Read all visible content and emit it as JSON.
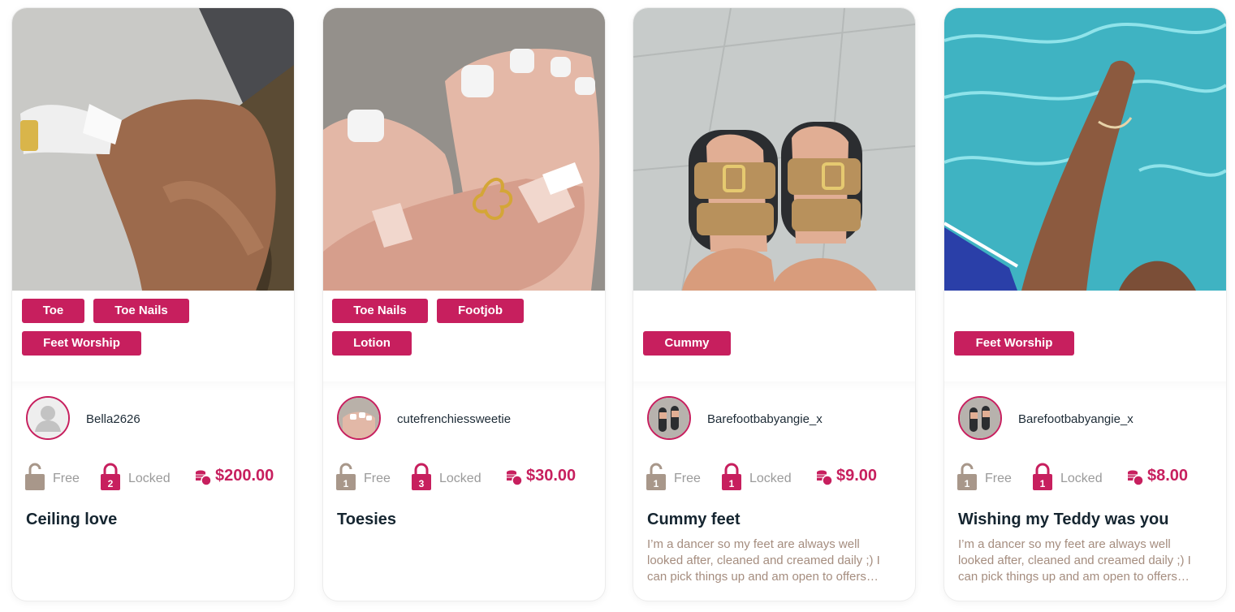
{
  "cards": [
    {
      "tags": [
        "Toe",
        "Toe Nails",
        "Feet Worship"
      ],
      "username": "Bella2626",
      "avatar": "default-avatar-icon",
      "free_count": "",
      "free_label": "Free",
      "locked_count": "2",
      "locked_label": "Locked",
      "price": "$200.00",
      "title": "Ceiling love",
      "description": ""
    },
    {
      "tags": [
        "Toe Nails",
        "Footjob",
        "Lotion"
      ],
      "username": "cutefrenchiessweetie",
      "avatar": "photo",
      "free_count": "1",
      "free_label": "Free",
      "locked_count": "3",
      "locked_label": "Locked",
      "price": "$30.00",
      "title": "Toesies",
      "description": ""
    },
    {
      "tags": [
        "Cummy"
      ],
      "username": "Barefootbabyangie_x",
      "avatar": "photo",
      "free_count": "1",
      "free_label": "Free",
      "locked_count": "1",
      "locked_label": "Locked",
      "price": "$9.00",
      "title": "Cummy feet",
      "description": "I’m a dancer so my feet are always well looked after, cleaned and creamed daily ;) I can pick things up and am open to offers…"
    },
    {
      "tags": [
        "Feet Worship"
      ],
      "username": "Barefootbabyangie_x",
      "avatar": "photo",
      "free_count": "1",
      "free_label": "Free",
      "locked_count": "1",
      "locked_label": "Locked",
      "price": "$8.00",
      "title": "Wishing my Teddy was you",
      "description": "I’m a dancer so my feet are always well looked after, cleaned and creamed daily ;) I can pick things up and am open to offers…"
    }
  ],
  "colors": {
    "accent": "#c71f5e",
    "lock_free": "#a8978a",
    "title": "#152530",
    "desc": "#a58d7f"
  },
  "icons": {
    "free": "unlocked-padlock-icon",
    "locked": "locked-padlock-icon",
    "price": "coins-icon"
  }
}
